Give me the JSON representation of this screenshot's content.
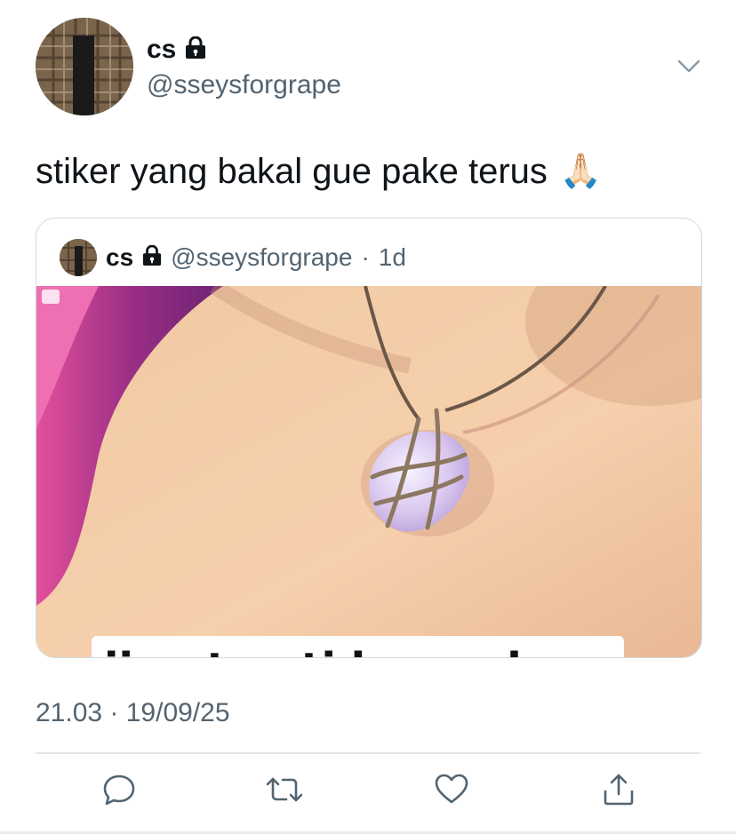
{
  "author": {
    "display_name": "cs",
    "handle": "@sseysforgrape",
    "protected_icon": "lock-icon",
    "avatar_icon": "avatar-image"
  },
  "tweet": {
    "text": "stiker yang bakal gue pake terus",
    "emoji": "🙏🏻"
  },
  "quoted_tweet": {
    "display_name": "cs",
    "handle": "@sseysforgrape",
    "time_separator": "·",
    "age": "1d",
    "image_caption": "jimat anti berondong"
  },
  "meta": {
    "timestamp": "21.03 · 19/09/25"
  },
  "actions": {
    "reply_icon": "reply-icon",
    "retweet_icon": "retweet-icon",
    "like_icon": "heart-icon",
    "share_icon": "share-icon"
  },
  "colors": {
    "secondary_text": "#536471",
    "border": "#cfd9de",
    "icon": "#536471"
  }
}
